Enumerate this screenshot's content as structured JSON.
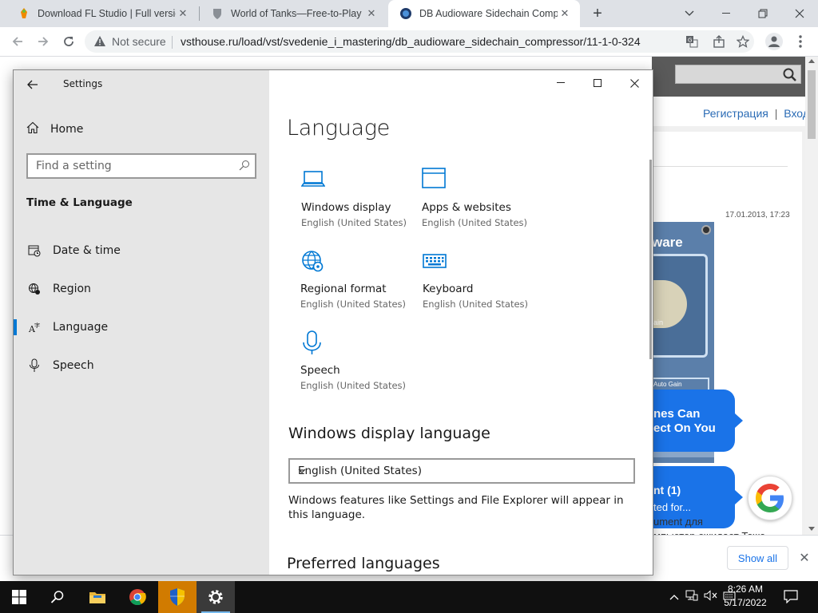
{
  "browser": {
    "tabs": [
      {
        "title": "Download FL Studio | Full version",
        "favicon": "fl-studio-icon",
        "active": false
      },
      {
        "title": "World of Tanks—Free-to-Play Tank",
        "favicon": "wot-shield-icon",
        "active": false
      },
      {
        "title": "DB Audioware Sidechain Compressor",
        "favicon": "site-globe-icon",
        "active": true
      }
    ],
    "new_tab_label": "+",
    "security_label": "Not secure",
    "url": "vsthouse.ru/load/vst/svedenie_i_mastering/db_audioware_sidechain_compressor/11-1-0-324"
  },
  "webpage": {
    "header_links": [
      "Регистрация",
      "|",
      "Вход"
    ],
    "date": "17.01.2013, 17:23",
    "plugin_logo": "ware",
    "plugin_sub": "ain",
    "plugin_button": "Auto Gain",
    "popup1": [
      "nes Can",
      "ect On You"
    ],
    "popup2": [
      "nt (1)",
      "ted for..."
    ],
    "bottom_text": "ument для",
    "bottom_text2": "мпьютер ожидает Тоже"
  },
  "downloads_bar": {
    "show_all_label": "Show all"
  },
  "settings": {
    "window_title": "Settings",
    "nav": {
      "home_label": "Home",
      "search_placeholder": "Find a setting",
      "section_heading": "Time & Language",
      "items": [
        {
          "label": "Date & time",
          "icon": "date-time-icon",
          "selected": false
        },
        {
          "label": "Region",
          "icon": "region-icon",
          "selected": false
        },
        {
          "label": "Language",
          "icon": "language-icon",
          "selected": true
        },
        {
          "label": "Speech",
          "icon": "microphone-icon",
          "selected": false
        }
      ]
    },
    "page_title": "Language",
    "tiles": [
      {
        "name": "Windows display",
        "sub": "English (United States)",
        "icon": "laptop-icon"
      },
      {
        "name": "Apps & websites",
        "sub": "English (United States)",
        "icon": "app-window-icon"
      },
      {
        "name": "Regional format",
        "sub": "English (United States)",
        "icon": "globe-settings-icon"
      },
      {
        "name": "Keyboard",
        "sub": "English (United States)",
        "icon": "keyboard-icon"
      },
      {
        "name": "Speech",
        "sub": "English (United States)",
        "icon": "microphone-icon"
      }
    ],
    "display_language": {
      "heading": "Windows display language",
      "selected": "English (United States)",
      "description": "Windows features like Settings and File Explorer will appear in this language."
    },
    "preferred_heading": "Preferred languages",
    "accent_color": "#0078d4"
  },
  "taskbar": {
    "time": "8:26 AM",
    "date": "5/17/2022"
  }
}
